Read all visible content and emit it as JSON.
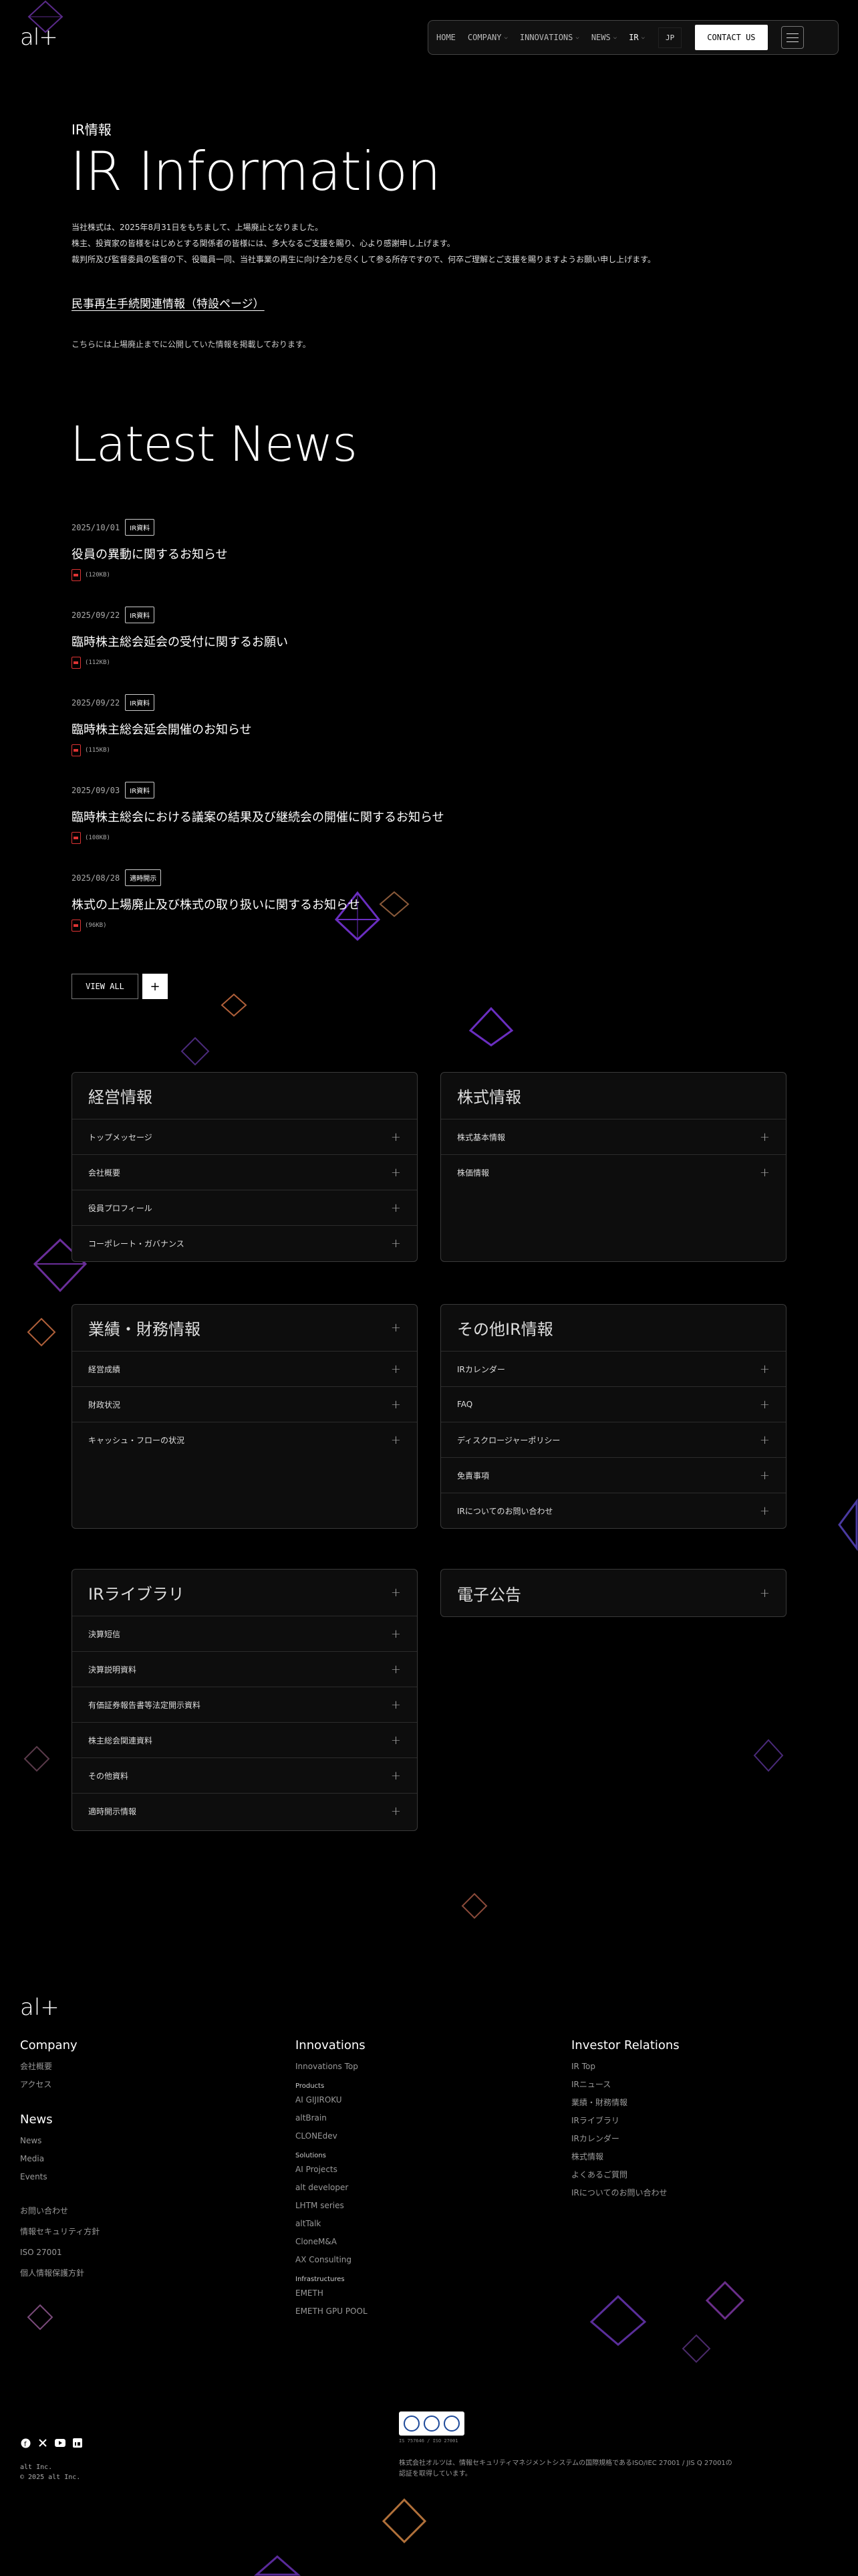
{
  "header": {
    "logo": "al+",
    "nav": [
      {
        "label": "HOME",
        "dropdown": false
      },
      {
        "label": "COMPANY",
        "dropdown": true
      },
      {
        "label": "INNOVATIONS",
        "dropdown": true
      },
      {
        "label": "NEWS",
        "dropdown": true
      },
      {
        "label": "IR",
        "dropdown": true
      }
    ],
    "lang": "JP",
    "contact": "CONTACT US"
  },
  "hero": {
    "subtitle": "IR情報",
    "title": "IR Information",
    "intro": [
      "当社株式は、2025年8月31日をもちまして、上場廃止となりました。",
      "株主、投資家の皆様をはじめとする関係者の皆様には、多大なるご支援を賜り、心より感謝申し上げます。",
      "裁判所及び監督委員の監督の下、役職員一同、当社事業の再生に向け全力を尽くして参る所存ですので、何卒ご理解とご支援を賜りますようお願い申し上げます。"
    ],
    "special_link": "民事再生手続関連情報（特設ページ）",
    "note": "こちらには上場廃止までに公開していた情報を掲載しております。"
  },
  "latest": {
    "title": "Latest News",
    "items": [
      {
        "date": "2025/10/01",
        "tag": "IR資料",
        "title": "役員の異動に関するお知らせ",
        "size": "(120KB)"
      },
      {
        "date": "2025/09/22",
        "tag": "IR資料",
        "title": "臨時株主総会延会の受付に関するお願い",
        "size": "(112KB)"
      },
      {
        "date": "2025/09/22",
        "tag": "IR資料",
        "title": "臨時株主総会延会開催のお知らせ",
        "size": "(115KB)"
      },
      {
        "date": "2025/09/03",
        "tag": "IR資料",
        "title": "臨時株主総会における議案の結果及び継続会の開催に関するお知らせ",
        "size": "(108KB)"
      },
      {
        "date": "2025/08/28",
        "tag": "適時開示",
        "title": "株式の上場廃止及び株式の取り扱いに関するお知らせ",
        "size": "(96KB)"
      }
    ],
    "view_all": "VIEW ALL",
    "plus": "+"
  },
  "cards": {
    "mgmt": {
      "title": "経営情報",
      "rows": [
        "トップメッセージ",
        "会社概要",
        "役員プロフィール",
        "コーポレート・ガバナンス"
      ]
    },
    "stock": {
      "title": "株式情報",
      "rows": [
        "株式基本情報",
        "株価情報"
      ]
    },
    "finance": {
      "title": "業績・財務情報",
      "rows": [
        "経営成績",
        "財政状況",
        "キャッシュ・フローの状況"
      ]
    },
    "other": {
      "title": "その他IR情報",
      "rows": [
        "IRカレンダー",
        "FAQ",
        "ディスクロージャーポリシー",
        "免責事項",
        "IRについてのお問い合わせ"
      ]
    },
    "library": {
      "title": "IRライブラリ",
      "rows": [
        "決算短信",
        "決算説明資料",
        "有価証券報告書等法定開示資料",
        "株主総会関連資料",
        "その他資料",
        "適時開示情報"
      ]
    },
    "notice": {
      "title": "電子公告"
    }
  },
  "footer": {
    "logo": "al+",
    "company": {
      "title": "Company",
      "links": [
        "会社概要",
        "アクセス"
      ]
    },
    "news": {
      "title": "News",
      "links": [
        "News",
        "Media",
        "Events"
      ]
    },
    "misc": [
      "お問い合わせ",
      "情報セキュリティ方針",
      "ISO 27001",
      "個人情報保護方針"
    ],
    "innovations": {
      "title": "Innovations",
      "top": "Innovations Top",
      "groups": [
        {
          "label": "Products",
          "links": [
            "AI GIJIROKU",
            "altBrain",
            "CLONEdev"
          ]
        },
        {
          "label": "Solutions",
          "links": [
            "AI Projects",
            "alt developer",
            "LHTM series",
            "altTalk",
            "CloneM&A",
            "AX Consulting"
          ]
        },
        {
          "label": "Infrastructures",
          "links": [
            "EMETH",
            "EMETH GPU POOL"
          ]
        }
      ]
    },
    "ir": {
      "title": "Investor Relations",
      "links": [
        "IR Top",
        "IRニュース",
        "業績・財務情報",
        "IRライブラリ",
        "IRカレンダー",
        "株式情報",
        "よくあるご質問",
        "IRについてのお問い合わせ"
      ]
    },
    "copy": [
      "alt Inc.",
      "© 2025 alt Inc."
    ],
    "cert_id": "IS 757646 / ISO 27001",
    "cert_text": "株式会社オルツは、情報セキュリティマネジメントシステムの国際規格であるISO/IEC 27001 / JIS Q 27001の認証を取得しています。"
  },
  "colors": {
    "background": "#000000",
    "accent_purple": "#7a3fd1",
    "accent_orange": "#c0703a",
    "pdf_red": "#dd3333"
  }
}
